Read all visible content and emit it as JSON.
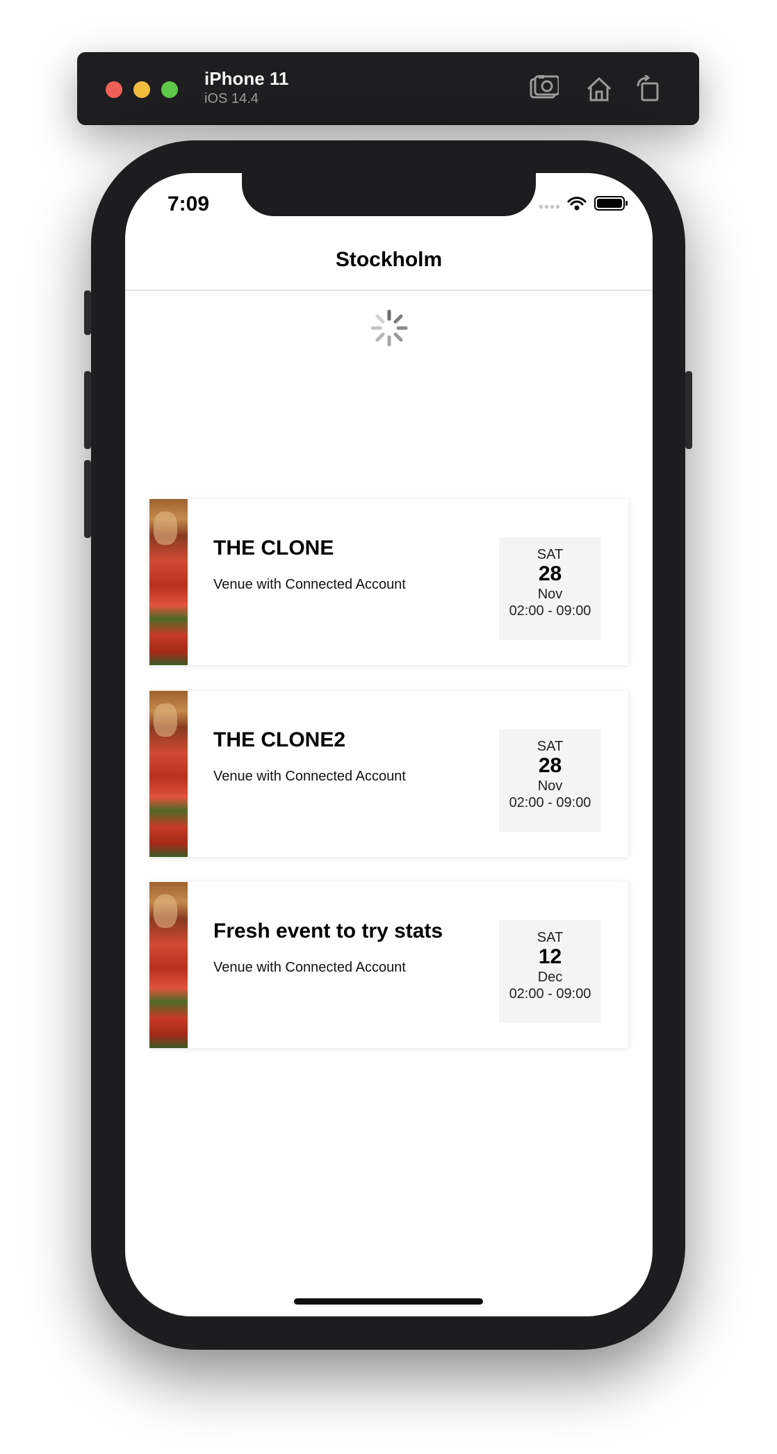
{
  "simulator": {
    "device_name": "iPhone 11",
    "os_version": "iOS 14.4",
    "tools": [
      "screenshot-icon",
      "home-icon",
      "rotate-icon"
    ]
  },
  "status_bar": {
    "time": "7:09"
  },
  "nav": {
    "title": "Stockholm"
  },
  "events": [
    {
      "title": "THE CLONE",
      "venue": "Venue with Connected Account",
      "weekday": "SAT",
      "day": "28",
      "month": "Nov",
      "time_range": "02:00 - 09:00"
    },
    {
      "title": "THE CLONE2",
      "venue": "Venue with Connected Account",
      "weekday": "SAT",
      "day": "28",
      "month": "Nov",
      "time_range": "02:00 - 09:00"
    },
    {
      "title": "Fresh event to try stats",
      "venue": "Venue with Connected Account",
      "weekday": "SAT",
      "day": "12",
      "month": "Dec",
      "time_range": "02:00 - 09:00"
    }
  ]
}
